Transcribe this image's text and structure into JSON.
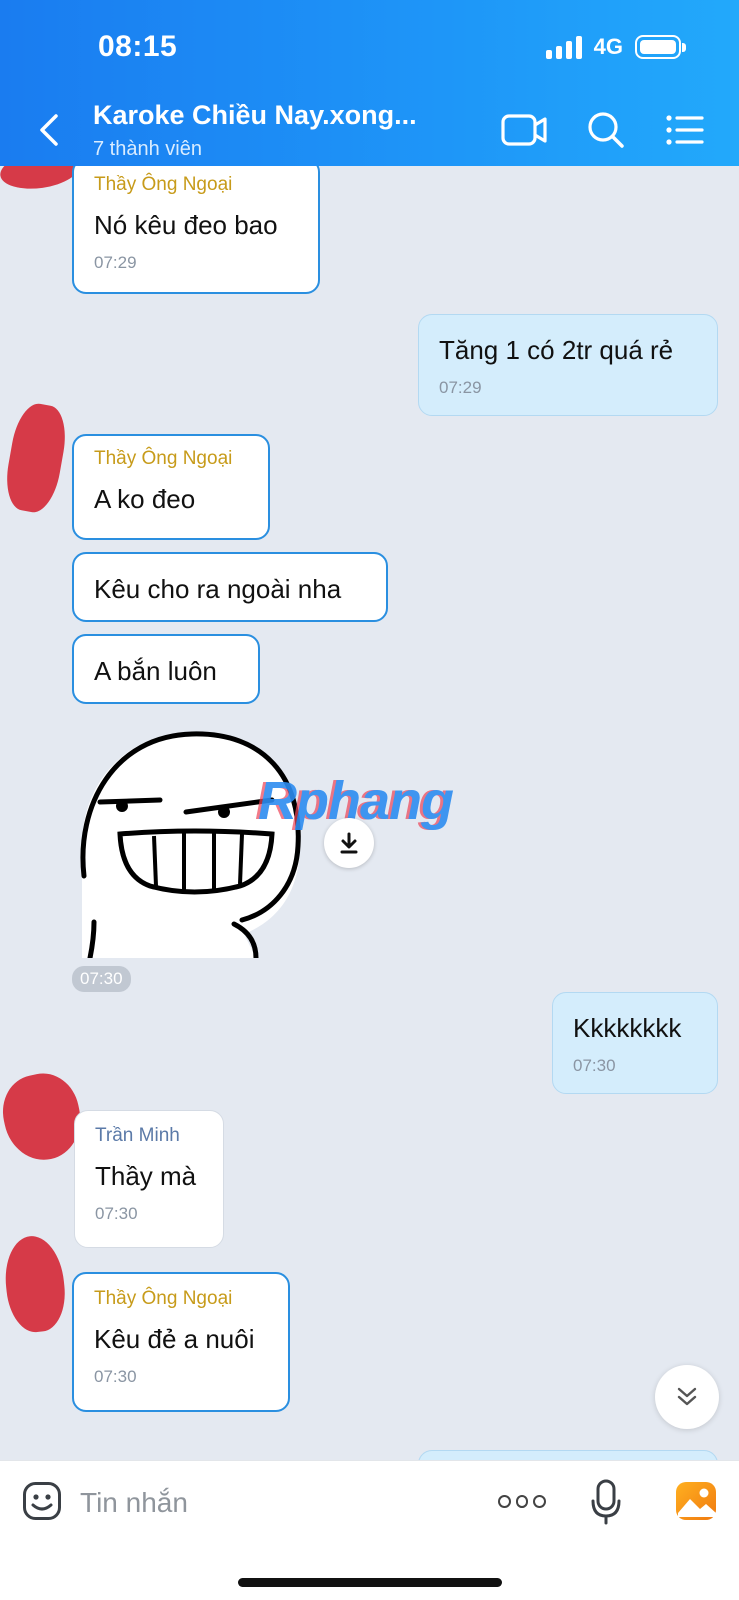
{
  "status_bar": {
    "time": "08:15",
    "network": "4G"
  },
  "header": {
    "title": "Karoke Chiều Nay.xong...",
    "subtitle": "7 thành viên"
  },
  "messages": [
    {
      "sender": "Thầy Ông Ngoại",
      "text": "Nó kêu đeo bao",
      "time": "07:29"
    },
    {
      "text": "Tăng 1 có 2tr quá rẻ",
      "time": "07:29"
    },
    {
      "sender": "Thầy Ông Ngoại",
      "text": "A ko đeo"
    },
    {
      "text": "Kêu cho ra ngoài nha"
    },
    {
      "text": "A bắn luôn"
    },
    {
      "time": "07:30"
    },
    {
      "text": "Kkkkkkkk",
      "time": "07:30"
    },
    {
      "sender": "Trần Minh",
      "text": "Thầy mà",
      "time": "07:30"
    },
    {
      "sender": "Thầy Ông Ngoại",
      "text": "Kêu đẻ a nuôi",
      "time": "07:30"
    }
  ],
  "watermark": "Rphang",
  "input": {
    "placeholder": "Tin nhắn"
  },
  "colors": {
    "header_start": "#1a7cf0",
    "header_end": "#22a9fb",
    "sender_gold": "#c79b1a",
    "sender_blue": "#5b7aa8",
    "outgoing_bubble": "#d4edfc",
    "chat_bg": "#e4e9f1"
  },
  "icons": [
    "back-icon",
    "video-call-icon",
    "search-icon",
    "menu-list-icon",
    "download-icon",
    "chevron-double-down-icon",
    "emoji-icon",
    "more-icon",
    "microphone-icon",
    "image-icon"
  ]
}
